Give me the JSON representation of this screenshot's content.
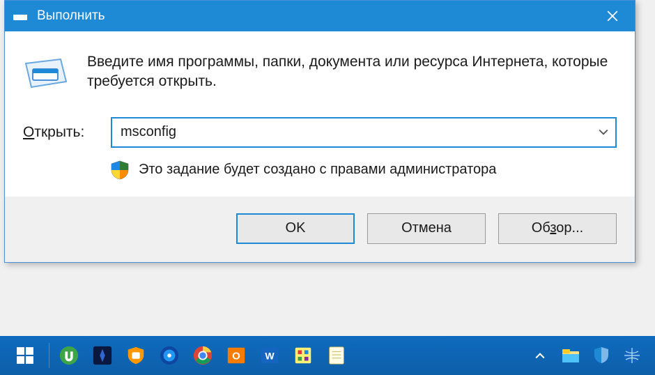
{
  "dialog": {
    "title": "Выполнить",
    "instruction": "Введите имя программы, папки, документа или ресурса Интернета, которые требуется открыть.",
    "open_label_prefix": "О",
    "open_label_rest": "ткрыть:",
    "input_value": "msconfig",
    "admin_note": "Это задание будет создано с правами администратора",
    "buttons": {
      "ok": "OK",
      "cancel": "Отмена",
      "browse_prefix": "Об",
      "browse_mnemonic": "з",
      "browse_rest": "ор..."
    }
  },
  "taskbar": {
    "apps": [
      "utorrent",
      "blizzard",
      "antivirus",
      "daemon-tools",
      "chrome",
      "onenote",
      "word",
      "paint",
      "notes"
    ],
    "tray": [
      "chevron-up",
      "explorer",
      "defender",
      "globe"
    ]
  }
}
